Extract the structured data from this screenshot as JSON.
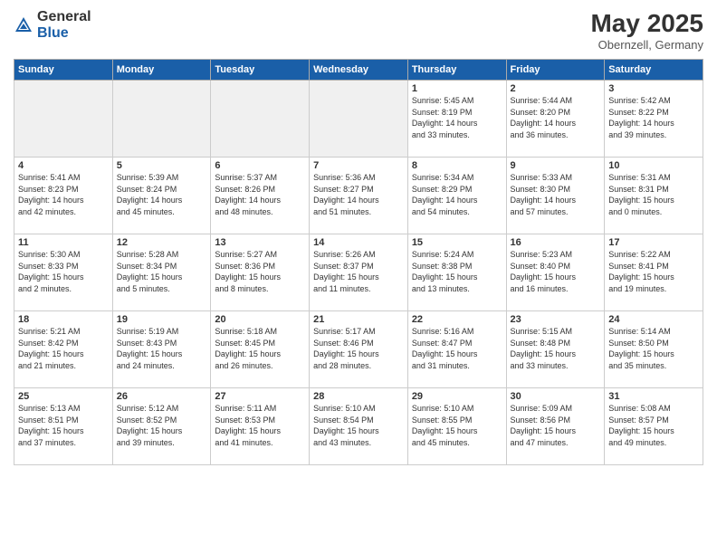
{
  "header": {
    "logo_general": "General",
    "logo_blue": "Blue",
    "month_year": "May 2025",
    "location": "Obernzell, Germany"
  },
  "days_of_week": [
    "Sunday",
    "Monday",
    "Tuesday",
    "Wednesday",
    "Thursday",
    "Friday",
    "Saturday"
  ],
  "weeks": [
    [
      {
        "day": "",
        "info": ""
      },
      {
        "day": "",
        "info": ""
      },
      {
        "day": "",
        "info": ""
      },
      {
        "day": "",
        "info": ""
      },
      {
        "day": "1",
        "info": "Sunrise: 5:45 AM\nSunset: 8:19 PM\nDaylight: 14 hours\nand 33 minutes."
      },
      {
        "day": "2",
        "info": "Sunrise: 5:44 AM\nSunset: 8:20 PM\nDaylight: 14 hours\nand 36 minutes."
      },
      {
        "day": "3",
        "info": "Sunrise: 5:42 AM\nSunset: 8:22 PM\nDaylight: 14 hours\nand 39 minutes."
      }
    ],
    [
      {
        "day": "4",
        "info": "Sunrise: 5:41 AM\nSunset: 8:23 PM\nDaylight: 14 hours\nand 42 minutes."
      },
      {
        "day": "5",
        "info": "Sunrise: 5:39 AM\nSunset: 8:24 PM\nDaylight: 14 hours\nand 45 minutes."
      },
      {
        "day": "6",
        "info": "Sunrise: 5:37 AM\nSunset: 8:26 PM\nDaylight: 14 hours\nand 48 minutes."
      },
      {
        "day": "7",
        "info": "Sunrise: 5:36 AM\nSunset: 8:27 PM\nDaylight: 14 hours\nand 51 minutes."
      },
      {
        "day": "8",
        "info": "Sunrise: 5:34 AM\nSunset: 8:29 PM\nDaylight: 14 hours\nand 54 minutes."
      },
      {
        "day": "9",
        "info": "Sunrise: 5:33 AM\nSunset: 8:30 PM\nDaylight: 14 hours\nand 57 minutes."
      },
      {
        "day": "10",
        "info": "Sunrise: 5:31 AM\nSunset: 8:31 PM\nDaylight: 15 hours\nand 0 minutes."
      }
    ],
    [
      {
        "day": "11",
        "info": "Sunrise: 5:30 AM\nSunset: 8:33 PM\nDaylight: 15 hours\nand 2 minutes."
      },
      {
        "day": "12",
        "info": "Sunrise: 5:28 AM\nSunset: 8:34 PM\nDaylight: 15 hours\nand 5 minutes."
      },
      {
        "day": "13",
        "info": "Sunrise: 5:27 AM\nSunset: 8:36 PM\nDaylight: 15 hours\nand 8 minutes."
      },
      {
        "day": "14",
        "info": "Sunrise: 5:26 AM\nSunset: 8:37 PM\nDaylight: 15 hours\nand 11 minutes."
      },
      {
        "day": "15",
        "info": "Sunrise: 5:24 AM\nSunset: 8:38 PM\nDaylight: 15 hours\nand 13 minutes."
      },
      {
        "day": "16",
        "info": "Sunrise: 5:23 AM\nSunset: 8:40 PM\nDaylight: 15 hours\nand 16 minutes."
      },
      {
        "day": "17",
        "info": "Sunrise: 5:22 AM\nSunset: 8:41 PM\nDaylight: 15 hours\nand 19 minutes."
      }
    ],
    [
      {
        "day": "18",
        "info": "Sunrise: 5:21 AM\nSunset: 8:42 PM\nDaylight: 15 hours\nand 21 minutes."
      },
      {
        "day": "19",
        "info": "Sunrise: 5:19 AM\nSunset: 8:43 PM\nDaylight: 15 hours\nand 24 minutes."
      },
      {
        "day": "20",
        "info": "Sunrise: 5:18 AM\nSunset: 8:45 PM\nDaylight: 15 hours\nand 26 minutes."
      },
      {
        "day": "21",
        "info": "Sunrise: 5:17 AM\nSunset: 8:46 PM\nDaylight: 15 hours\nand 28 minutes."
      },
      {
        "day": "22",
        "info": "Sunrise: 5:16 AM\nSunset: 8:47 PM\nDaylight: 15 hours\nand 31 minutes."
      },
      {
        "day": "23",
        "info": "Sunrise: 5:15 AM\nSunset: 8:48 PM\nDaylight: 15 hours\nand 33 minutes."
      },
      {
        "day": "24",
        "info": "Sunrise: 5:14 AM\nSunset: 8:50 PM\nDaylight: 15 hours\nand 35 minutes."
      }
    ],
    [
      {
        "day": "25",
        "info": "Sunrise: 5:13 AM\nSunset: 8:51 PM\nDaylight: 15 hours\nand 37 minutes."
      },
      {
        "day": "26",
        "info": "Sunrise: 5:12 AM\nSunset: 8:52 PM\nDaylight: 15 hours\nand 39 minutes."
      },
      {
        "day": "27",
        "info": "Sunrise: 5:11 AM\nSunset: 8:53 PM\nDaylight: 15 hours\nand 41 minutes."
      },
      {
        "day": "28",
        "info": "Sunrise: 5:10 AM\nSunset: 8:54 PM\nDaylight: 15 hours\nand 43 minutes."
      },
      {
        "day": "29",
        "info": "Sunrise: 5:10 AM\nSunset: 8:55 PM\nDaylight: 15 hours\nand 45 minutes."
      },
      {
        "day": "30",
        "info": "Sunrise: 5:09 AM\nSunset: 8:56 PM\nDaylight: 15 hours\nand 47 minutes."
      },
      {
        "day": "31",
        "info": "Sunrise: 5:08 AM\nSunset: 8:57 PM\nDaylight: 15 hours\nand 49 minutes."
      }
    ]
  ]
}
